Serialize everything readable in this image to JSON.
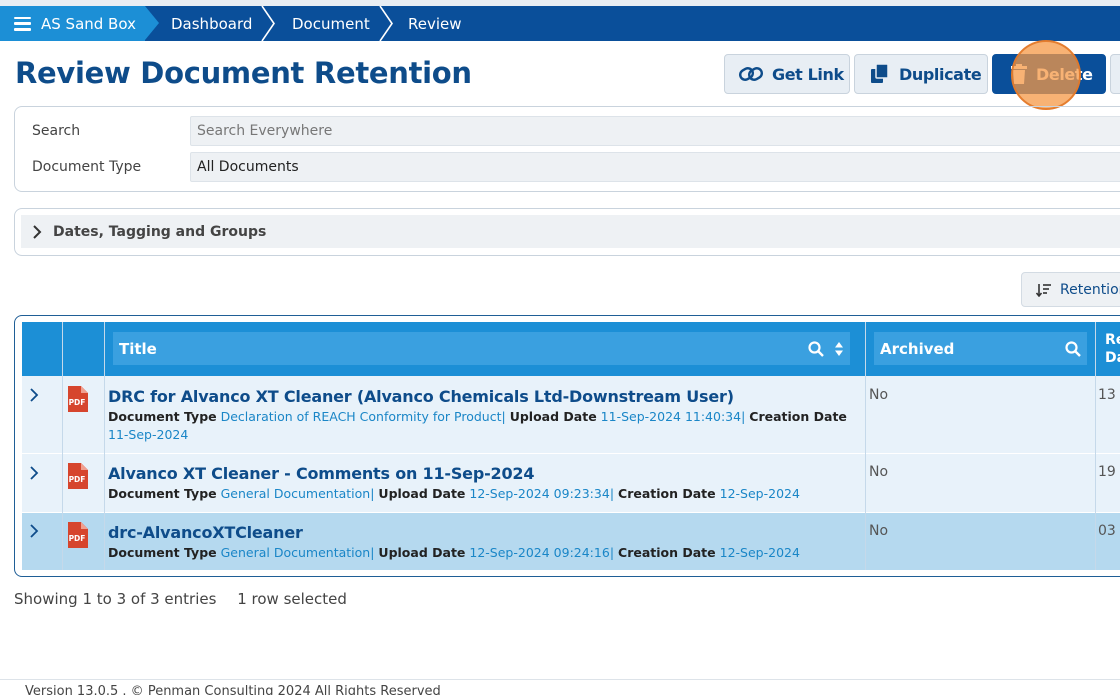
{
  "breadcrumb": {
    "home": "AS Sand Box",
    "items": [
      "Dashboard",
      "Document",
      "Review"
    ]
  },
  "page": {
    "title": "Review Document Retention"
  },
  "toolbar": {
    "get_link": "Get Link",
    "duplicate": "Duplicate",
    "delete": "Delete"
  },
  "filters": {
    "search_label": "Search",
    "search_placeholder": "Search Everywhere",
    "doctype_label": "Document Type",
    "doctype_value": "All Documents"
  },
  "accordion": {
    "label": "Dates, Tagging and Groups"
  },
  "sort": {
    "label": "Retention"
  },
  "table": {
    "headers": {
      "title": "Title",
      "archived": "Archived",
      "date_partial_top": "Re",
      "date_partial_bottom": "Da"
    },
    "meta_labels": {
      "doc_type": "Document Type",
      "upload": "Upload Date",
      "creation": "Creation Date"
    },
    "rows": [
      {
        "title": "DRC for Alvanco XT Cleaner (Alvanco Chemicals Ltd-Downstream User)",
        "doc_type": "Declaration of REACH Conformity for Product",
        "upload_date": "11-Sep-2024 11:40:34",
        "creation_date": "11-Sep-2024",
        "archived": "No",
        "date_partial": "13"
      },
      {
        "title": "Alvanco XT Cleaner - Comments on 11-Sep-2024",
        "doc_type": "General Documentation",
        "upload_date": "12-Sep-2024 09:23:34",
        "creation_date": "12-Sep-2024",
        "archived": "No",
        "date_partial": "19"
      },
      {
        "title": "drc-AlvancoXTCleaner",
        "doc_type": "General Documentation",
        "upload_date": "12-Sep-2024 09:24:16",
        "creation_date": "12-Sep-2024",
        "archived": "No",
        "date_partial": "03"
      }
    ]
  },
  "status": {
    "showing": "Showing 1 to 3 of 3 entries",
    "selected": "1 row selected"
  },
  "footer": {
    "text": "Version 13.0.5 . © Penman Consulting 2024 All Rights Reserved"
  },
  "colors": {
    "brand_dark": "#0a4f9a",
    "brand_light": "#1c8fd6",
    "selected_row": "#b5d9ef",
    "link": "#1a86c7"
  }
}
